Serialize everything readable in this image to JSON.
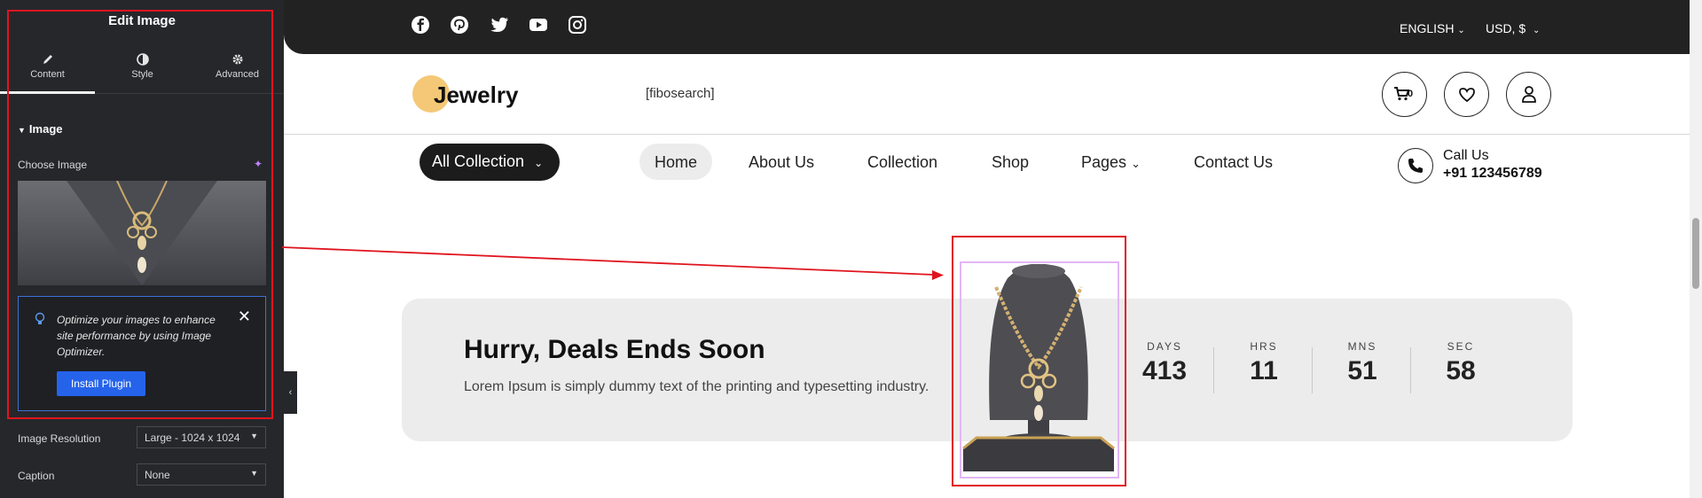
{
  "editor": {
    "title": "Edit Image",
    "tabs": [
      {
        "label": "Content",
        "icon": "pencil-icon",
        "active": true
      },
      {
        "label": "Style",
        "icon": "half-circle-icon",
        "active": false
      },
      {
        "label": "Advanced",
        "icon": "gear-icon",
        "active": false
      }
    ],
    "section": "Image",
    "choose_label": "Choose Image",
    "notice_text": "Optimize your images to enhance site performance by using Image Optimizer.",
    "install_label": "Install Plugin",
    "resolution_label": "Image Resolution",
    "resolution_value": "Large - 1024 x 1024",
    "caption_label": "Caption",
    "caption_value": "None"
  },
  "topbar": {
    "social": [
      "facebook-icon",
      "pinterest-icon",
      "twitter-icon",
      "youtube-icon",
      "instagram-icon"
    ],
    "language": "ENGLISH",
    "currency": "USD, $"
  },
  "header": {
    "logo": "Jewelry",
    "search_shortcode": "[fibosearch]",
    "cart_count": "0"
  },
  "nav": {
    "all_collection": "All Collection",
    "items": [
      "Home",
      "About Us",
      "Collection",
      "Shop",
      "Pages",
      "Contact Us"
    ],
    "call_label": "Call Us",
    "call_number": "+91 123456789"
  },
  "deal": {
    "title": "Hurry, Deals Ends Soon",
    "subtitle": "Lorem Ipsum is simply dummy text of the printing and typesetting industry.",
    "countdown": [
      {
        "label": "DAYS",
        "value": "413"
      },
      {
        "label": "HRS",
        "value": "11"
      },
      {
        "label": "MNS",
        "value": "51"
      },
      {
        "label": "SEC",
        "value": "58"
      }
    ]
  },
  "colors": {
    "accent_red": "#e0141e",
    "editor_bg": "#26272b",
    "button_blue": "#2563eb",
    "logo_gold": "#f4c876"
  }
}
